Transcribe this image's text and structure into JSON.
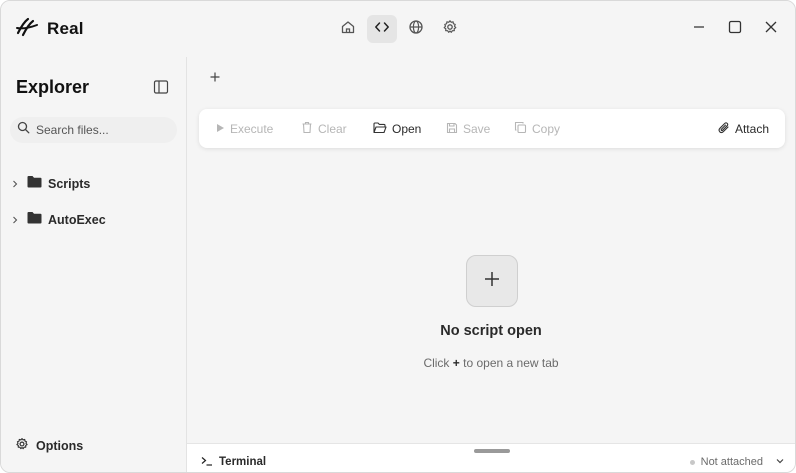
{
  "app": {
    "title": "Real"
  },
  "nav": {
    "items": [
      "home-icon",
      "code-icon",
      "globe-icon",
      "gear-icon"
    ],
    "active": "code-icon"
  },
  "window_controls": [
    "minimize-icon",
    "maximize-icon",
    "close-icon"
  ],
  "sidebar": {
    "title": "Explorer",
    "search_placeholder": "Search files...",
    "items": [
      {
        "label": "Scripts",
        "icon": "folder-icon"
      },
      {
        "label": "AutoExec",
        "icon": "folder-icon"
      }
    ],
    "options_label": "Options"
  },
  "toolbar": {
    "execute_label": "Execute",
    "clear_label": "Clear",
    "open_label": "Open",
    "save_label": "Save",
    "copy_label": "Copy",
    "attach_label": "Attach"
  },
  "empty_state": {
    "title": "No script open",
    "hint_prefix": "Click",
    "hint_plus": "+",
    "hint_suffix": "to open a new tab"
  },
  "terminal": {
    "label": "Terminal",
    "status": "Not attached"
  },
  "colors": {
    "background": "#f5f5f5",
    "panel": "#ffffff",
    "disabled": "#b6b6b6",
    "text": "#2a2a2a"
  }
}
